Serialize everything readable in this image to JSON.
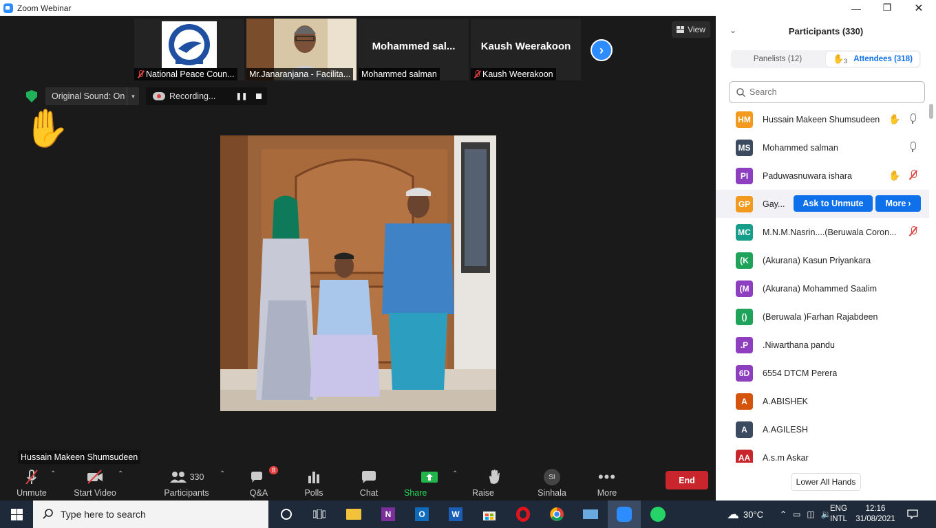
{
  "window": {
    "title": "Zoom Webinar"
  },
  "thumbnails": [
    {
      "label": "National Peace Coun...",
      "big_name": "",
      "muted": true,
      "kind": "logo"
    },
    {
      "label": "Mr.Janaranjana - Facilita...",
      "big_name": "",
      "muted": false,
      "kind": "video"
    },
    {
      "label": "Mohammed salman",
      "big_name": "Mohammed  sal...",
      "muted": false,
      "kind": "name"
    },
    {
      "label": "Kaush Weerakoon",
      "big_name": "Kaush Weerakoon",
      "muted": true,
      "kind": "name"
    }
  ],
  "view_button": "View",
  "original_sound": "Original Sound: On",
  "recording": "Recording...",
  "active_speaker": "Hussain Makeen Shumsudeen",
  "toolbar": {
    "unmute": "Unmute",
    "start_video": "Start Video",
    "participants": "Participants",
    "participants_count": "330",
    "qa": "Q&A",
    "qa_badge": "8",
    "polls": "Polls",
    "chat": "Chat",
    "share_screen": "Share Screen",
    "raise_hand": "Raise Hand",
    "sinhala": "Sinhala",
    "sinhala_initials": "SI",
    "more": "More",
    "end": "End"
  },
  "panel": {
    "title": "Participants (330)",
    "tabs": [
      {
        "label": "Panelists (12)",
        "active": false
      },
      {
        "label": "Attendees (318)",
        "active": true,
        "hand_count": "3"
      }
    ],
    "search_placeholder": "Search",
    "ask_to_unmute": "Ask to Unmute",
    "more": "More",
    "lower_all_hands": "Lower All Hands",
    "participants": [
      {
        "initials": "HM",
        "name": "Hussain Makeen Shumsudeen",
        "color": "#f29a1e",
        "hand": true,
        "mic": "on"
      },
      {
        "initials": "MS",
        "name": "Mohammed salman",
        "color": "#3b4a5e",
        "hand": false,
        "mic": "on"
      },
      {
        "initials": "PI",
        "name": "Paduwasnuwara ishara",
        "color": "#8e3fbf",
        "hand": true,
        "mic": "off"
      },
      {
        "initials": "GP",
        "name": "Gay...",
        "color": "#f29a1e",
        "hand": false,
        "mic": "none"
      },
      {
        "initials": "MC",
        "name": "M.N.M.Nasrin....(Beruwala Coron...",
        "color": "#179e8a",
        "hand": false,
        "mic": "off"
      },
      {
        "initials": "(K",
        "name": "(Akurana) Kasun Priyankara",
        "color": "#1fa35a",
        "hand": false,
        "mic": "none"
      },
      {
        "initials": "(M",
        "name": "(Akurana) Mohammed Saalim",
        "color": "#8e3fbf",
        "hand": false,
        "mic": "none"
      },
      {
        "initials": "()",
        "name": "(Beruwala )Farhan Rajabdeen",
        "color": "#1fa35a",
        "hand": false,
        "mic": "none"
      },
      {
        "initials": ".P",
        "name": ".Niwarthana pandu",
        "color": "#8e3fbf",
        "hand": false,
        "mic": "none"
      },
      {
        "initials": "6D",
        "name": "6554 DTCM Perera",
        "color": "#8e3fbf",
        "hand": false,
        "mic": "none"
      },
      {
        "initials": "A",
        "name": "A.ABISHEK",
        "color": "#d4540b",
        "hand": false,
        "mic": "none"
      },
      {
        "initials": "A",
        "name": "A.AGILESH",
        "color": "#3b4a5e",
        "hand": false,
        "mic": "none"
      },
      {
        "initials": "AA",
        "name": "A.s.m Askar",
        "color": "#c8262c",
        "hand": false,
        "mic": "none"
      }
    ]
  },
  "taskbar": {
    "search_placeholder": "Type here to search",
    "temperature": "30°C",
    "lang1": "ENG",
    "lang2": "INTL",
    "time": "12:16",
    "date": "31/08/2021"
  }
}
